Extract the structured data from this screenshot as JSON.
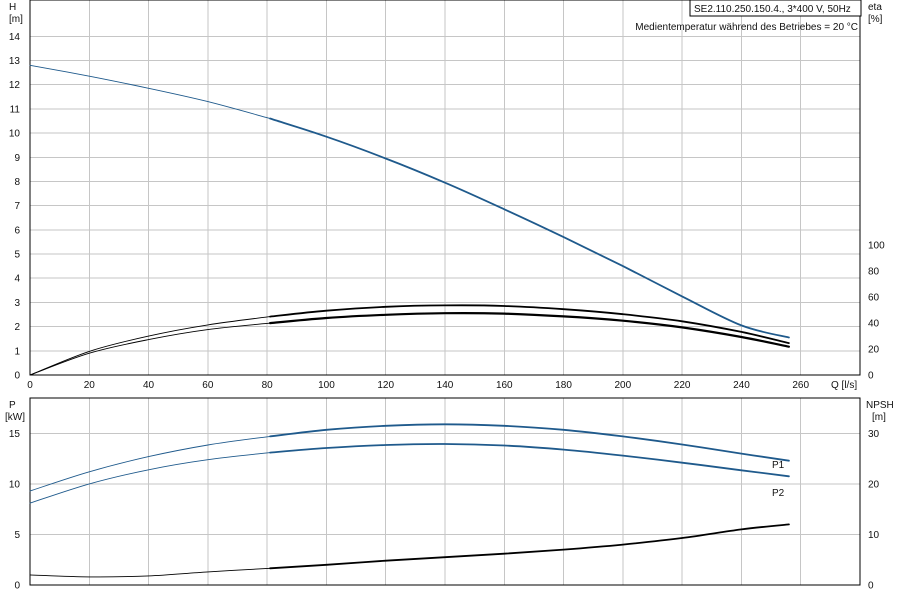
{
  "header": {
    "model": "SE2.110.250.150.4., 3*400 V, 50Hz",
    "medium": "Medientemperatur während des Betriebes = 20 °C"
  },
  "colors": {
    "blue": "#1f5a8c",
    "black": "#000000",
    "grid": "#c6c6c6"
  },
  "chart_data": [
    {
      "type": "line",
      "name": "head-efficiency",
      "x_label": "Q [l/s]",
      "y_left_label": [
        "H",
        "[m]"
      ],
      "y_right_label": [
        "eta",
        "[%]"
      ],
      "xlim": [
        0,
        280
      ],
      "ylim_left": [
        0,
        15.5
      ],
      "ylim_right": [
        0,
        100
      ],
      "x_ticks": [
        0,
        20,
        40,
        60,
        80,
        100,
        120,
        140,
        160,
        180,
        200,
        220,
        240,
        260
      ],
      "y_left_ticks": [
        0,
        1,
        2,
        3,
        4,
        5,
        6,
        7,
        8,
        9,
        10,
        11,
        12,
        13,
        14
      ],
      "y_right_ticks": [
        0,
        20,
        40,
        60,
        80,
        100
      ],
      "grid": true,
      "series": [
        {
          "key": "H",
          "axis": "left",
          "color": "#1f5a8c",
          "x": [
            0,
            20,
            40,
            60,
            81,
            100,
            120,
            140,
            160,
            180,
            200,
            220,
            240,
            256
          ],
          "y": [
            12.8,
            12.35,
            11.85,
            11.3,
            10.6,
            9.85,
            8.95,
            7.95,
            6.85,
            5.7,
            4.5,
            3.25,
            2.05,
            1.55
          ]
        },
        {
          "key": "eta-upper",
          "axis": "right",
          "color": "#000000",
          "x": [
            0,
            20,
            40,
            60,
            81,
            100,
            120,
            140,
            160,
            180,
            200,
            220,
            240,
            256
          ],
          "y": [
            0,
            20,
            33,
            42.5,
            49.5,
            54.5,
            57.8,
            59,
            58.5,
            55.8,
            51.5,
            45.5,
            36.5,
            27
          ]
        },
        {
          "key": "eta-lower",
          "axis": "right",
          "color": "#000000",
          "x": [
            0,
            20,
            40,
            60,
            81,
            100,
            120,
            140,
            160,
            180,
            200,
            220,
            240,
            256
          ],
          "y": [
            0,
            18.5,
            30,
            38.5,
            44,
            48.3,
            51,
            52.4,
            52,
            49.7,
            46,
            40.3,
            32.2,
            24
          ]
        }
      ]
    },
    {
      "type": "line",
      "name": "power-npsh",
      "y_left_label": [
        "P",
        "[kW]"
      ],
      "y_right_label": [
        "NPSH",
        "[m]"
      ],
      "xlim": [
        0,
        280
      ],
      "ylim_left": [
        0,
        18.5
      ],
      "ylim_right": [
        0,
        37
      ],
      "y_left_ticks": [
        0,
        5,
        10,
        15
      ],
      "y_right_ticks": [
        0,
        10,
        20,
        30
      ],
      "grid": true,
      "series": [
        {
          "key": "P1",
          "name": "P1",
          "axis": "left",
          "color": "#1f5a8c",
          "x": [
            0,
            20,
            40,
            60,
            81,
            100,
            120,
            140,
            160,
            180,
            200,
            220,
            240,
            256
          ],
          "y": [
            9.3,
            11.2,
            12.7,
            13.85,
            14.7,
            15.35,
            15.75,
            15.9,
            15.75,
            15.35,
            14.7,
            13.9,
            13,
            12.3
          ]
        },
        {
          "key": "P2",
          "name": "P2",
          "axis": "left",
          "color": "#1f5a8c",
          "x": [
            0,
            20,
            40,
            60,
            81,
            100,
            120,
            140,
            160,
            180,
            200,
            220,
            240,
            256
          ],
          "y": [
            8.1,
            10,
            11.4,
            12.4,
            13.1,
            13.55,
            13.85,
            13.95,
            13.8,
            13.4,
            12.8,
            12.1,
            11.35,
            10.75
          ]
        },
        {
          "key": "NPSH",
          "axis": "right",
          "color": "#000000",
          "x": [
            0,
            20,
            40,
            60,
            81,
            100,
            120,
            140,
            160,
            180,
            200,
            220,
            240,
            256
          ],
          "y": [
            2,
            1.6,
            1.8,
            2.6,
            3.3,
            4,
            4.8,
            5.5,
            6.2,
            7,
            8,
            9.3,
            11,
            12
          ]
        }
      ]
    }
  ]
}
